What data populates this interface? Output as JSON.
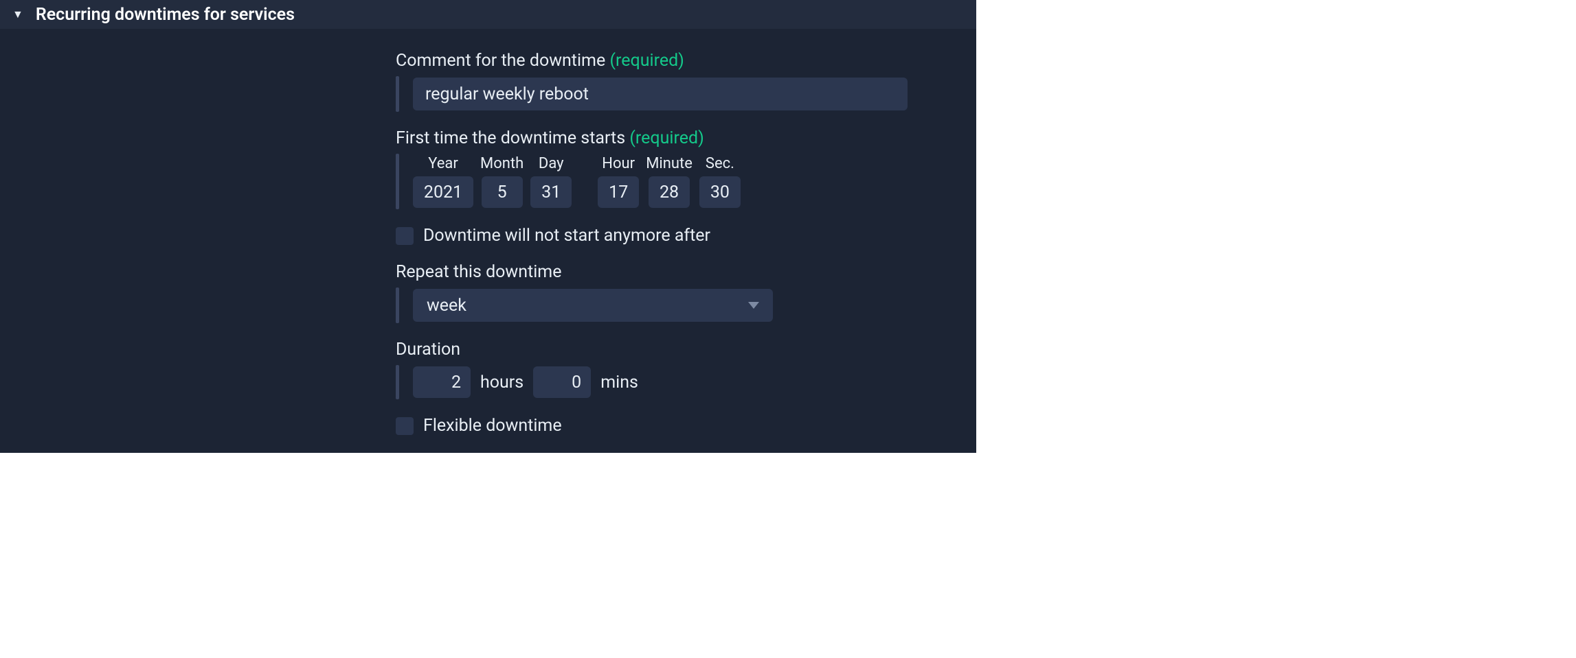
{
  "header": {
    "title": "Recurring downtimes for services"
  },
  "fields": {
    "comment": {
      "label": "Comment for the downtime",
      "required_mark": "(required)",
      "value": "regular weekly reboot"
    },
    "first_start": {
      "label": "First time the downtime starts",
      "required_mark": "(required)",
      "cols": {
        "year": {
          "label": "Year",
          "value": "2021"
        },
        "month": {
          "label": "Month",
          "value": "5"
        },
        "day": {
          "label": "Day",
          "value": "31"
        },
        "hour": {
          "label": "Hour",
          "value": "17"
        },
        "minute": {
          "label": "Minute",
          "value": "28"
        },
        "sec": {
          "label": "Sec.",
          "value": "30"
        }
      }
    },
    "end_after": {
      "label": "Downtime will not start anymore after"
    },
    "repeat": {
      "label": "Repeat this downtime",
      "value": "week"
    },
    "duration": {
      "label": "Duration",
      "hours": "2",
      "hours_unit": "hours",
      "mins": "0",
      "mins_unit": "mins"
    },
    "flexible": {
      "label": "Flexible downtime"
    }
  }
}
